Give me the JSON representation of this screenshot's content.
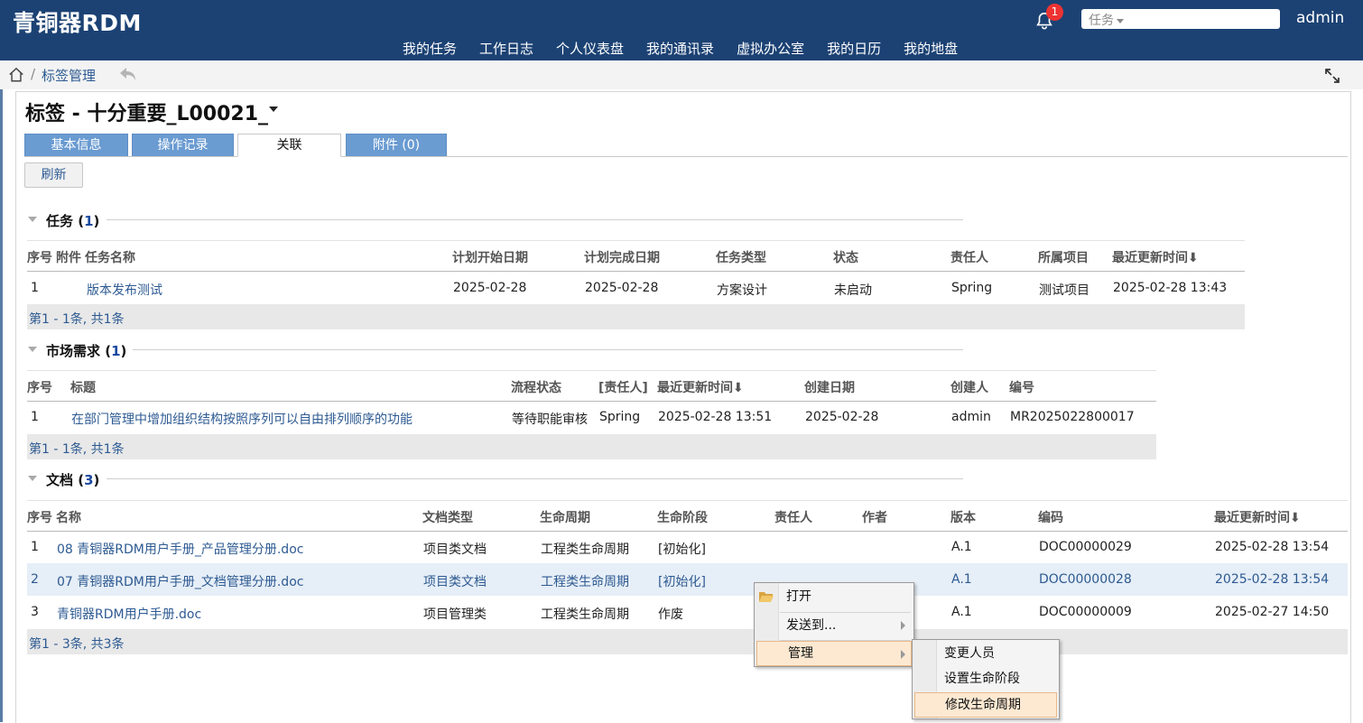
{
  "header": {
    "brand": "青铜器RDM",
    "notif_count": "1",
    "search_select": "任务",
    "user": "admin",
    "nav": [
      "我的任务",
      "工作日志",
      "个人仪表盘",
      "我的通讯录",
      "虚拟办公室",
      "我的日历",
      "我的地盘"
    ]
  },
  "breadcrumb": {
    "sep": "/",
    "current": "标签管理"
  },
  "page": {
    "title": "标签 - 十分重要_L00021_",
    "tabs": [
      "基本信息",
      "操作记录",
      "关联",
      "附件 (0)"
    ],
    "active_tab": "关联",
    "refresh": "刷新"
  },
  "tasks": {
    "title": "任务",
    "count": "1",
    "headers": [
      "序号",
      "附件",
      "任务名称",
      "计划开始日期",
      "计划完成日期",
      "任务类型",
      "状态",
      "责任人",
      "所属项目",
      "最近更新时间⬇"
    ],
    "rows": [
      {
        "no": "1",
        "name": "版本发布测试",
        "start": "2025-02-28",
        "end": "2025-02-28",
        "type": "方案设计",
        "status": "未启动",
        "owner": "Spring",
        "project": "测试项目",
        "updated": "2025-02-28 13:43"
      }
    ],
    "pager": "第1 - 1条, 共1条"
  },
  "requirements": {
    "title": "市场需求",
    "count": "1",
    "headers": [
      "序号",
      "标题",
      "流程状态",
      "[责任人]",
      "最近更新时间⬇",
      "创建日期",
      "创建人",
      "编号"
    ],
    "rows": [
      {
        "no": "1",
        "title": "在部门管理中增加组织结构按照序列可以自由排列顺序的功能",
        "flow": "等待职能审核",
        "owner": "Spring",
        "updated": "2025-02-28 13:51",
        "created": "2025-02-28",
        "creator": "admin",
        "code": "MR2025022800017"
      }
    ],
    "pager": "第1 - 1条, 共1条"
  },
  "documents": {
    "title": "文档",
    "count": "3",
    "headers": [
      "序号",
      "名称",
      "文档类型",
      "生命周期",
      "生命阶段",
      "责任人",
      "作者",
      "版本",
      "编码",
      "最近更新时间⬇"
    ],
    "rows": [
      {
        "no": "1",
        "name": "08 青铜器RDM用户手册_产品管理分册.doc",
        "type": "项目类文档",
        "lifecycle": "工程类生命周期",
        "stage": "[初始化]",
        "version": "A.1",
        "code": "DOC00000029",
        "updated": "2025-02-28 13:54"
      },
      {
        "no": "2",
        "name": "07 青铜器RDM用户手册_文档管理分册.doc",
        "type": "项目类文档",
        "lifecycle": "工程类生命周期",
        "stage": "[初始化]",
        "version": "A.1",
        "code": "DOC00000028",
        "updated": "2025-02-28 13:54"
      },
      {
        "no": "3",
        "name": "青铜器RDM用户手册.doc",
        "type": "项目管理类",
        "lifecycle": "工程类生命周期",
        "stage": "作废",
        "version": "A.1",
        "code": "DOC00000009",
        "updated": "2025-02-27 14:50"
      }
    ],
    "pager": "第1 - 3条, 共3条"
  },
  "context_menu": {
    "items": [
      "打开",
      "发送到...",
      "管理"
    ],
    "submenu": [
      "变更人员",
      "设置生命阶段",
      "修改生命周期"
    ]
  },
  "colors": {
    "topbar": "#1c4274",
    "tab": "#6a9bd1",
    "link": "#2d5a92",
    "highlight_row": "#e6eef7",
    "menu_highlight": "#fde9d2"
  }
}
